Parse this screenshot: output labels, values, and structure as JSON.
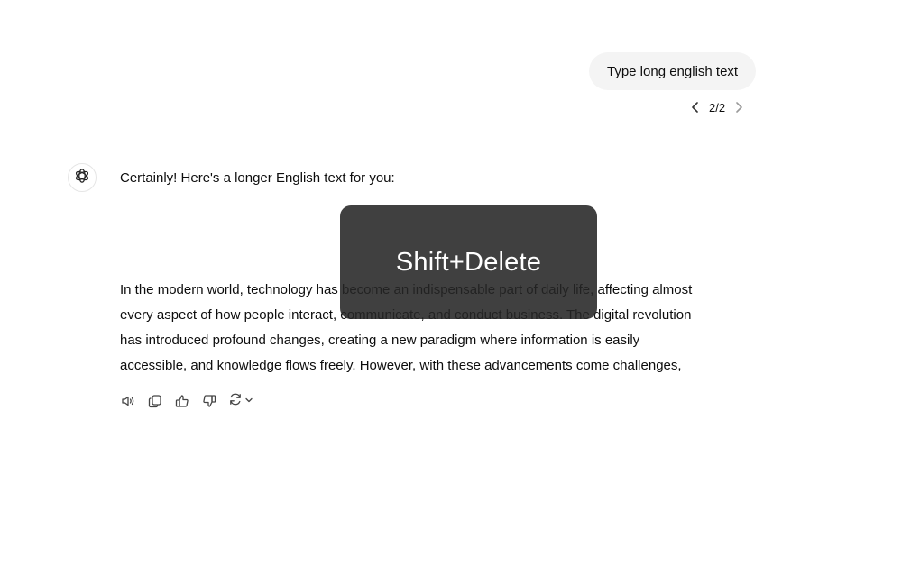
{
  "user_message": {
    "text": "Type long english text"
  },
  "pagination": {
    "label": "2/2",
    "prev_icon": "chevron-left-icon",
    "next_icon": "chevron-right-icon"
  },
  "assistant": {
    "avatar_icon": "openai-logo-icon",
    "intro": "Certainly! Here's a longer English text for you:",
    "paragraph_lines": [
      "In the modern world, technology has become an indispensable part of daily life, affecting almost",
      "every aspect of how people interact, communicate, and conduct business. The digital revolution",
      "has introduced profound changes, creating a new paradigm where information is easily",
      "accessible, and knowledge flows freely. However, with these advancements come challenges,"
    ]
  },
  "actions": [
    {
      "icon": "speaker-icon"
    },
    {
      "icon": "copy-icon"
    },
    {
      "icon": "thumbs-up-icon"
    },
    {
      "icon": "thumbs-down-icon"
    },
    {
      "icon": "regenerate-icon"
    }
  ],
  "overlay": {
    "text": "Shift+Delete"
  },
  "colors": {
    "bubble_bg": "#f4f4f4",
    "text": "#0d0d0d",
    "overlay_bg": "#262626",
    "divider": "#dcdcdc"
  }
}
